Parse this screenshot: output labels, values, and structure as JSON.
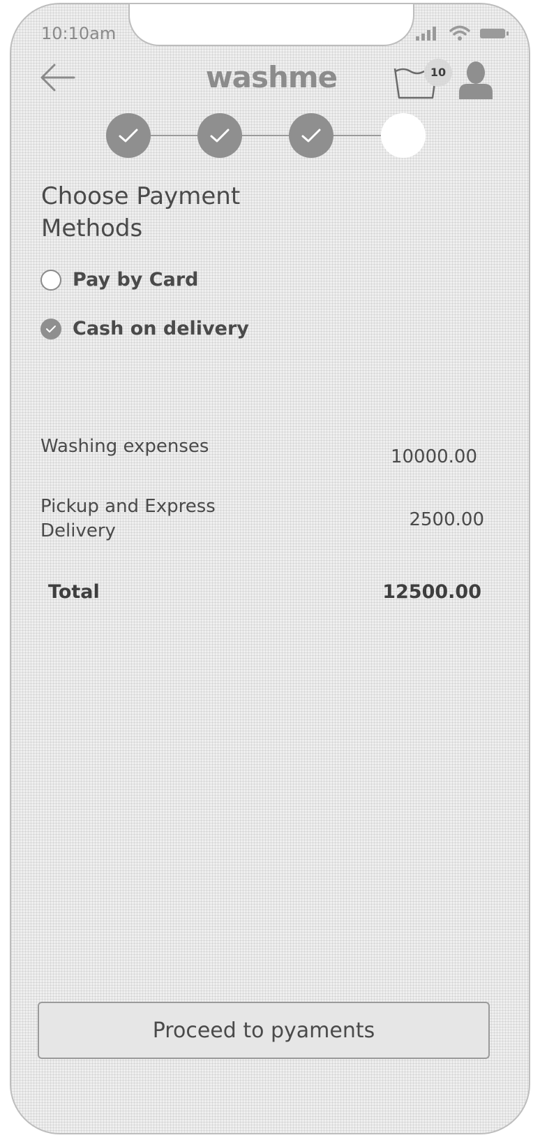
{
  "status_bar": {
    "time": "10:10am",
    "icons": [
      "signal-icon",
      "wifi-icon",
      "battery-icon"
    ]
  },
  "header": {
    "back_icon": "arrow-left-icon",
    "brand": "washme",
    "basket_icon": "laundry-basket-icon",
    "basket_count": "10",
    "profile_icon": "user-icon"
  },
  "stepper": {
    "total_steps": 4,
    "completed_steps": 3
  },
  "payment": {
    "heading": "Choose Payment Methods",
    "options": [
      {
        "label": "Pay by Card",
        "selected": false
      },
      {
        "label": "Cash on delivery",
        "selected": true
      }
    ]
  },
  "summary": {
    "rows": [
      {
        "label": "Washing expenses",
        "value": "10000.00"
      },
      {
        "label": "Pickup and Express Delivery",
        "value": "2500.00"
      }
    ],
    "total_label": "Total",
    "total_value": "12500.00"
  },
  "footer": {
    "proceed_label": "Proceed to pyaments"
  },
  "colors": {
    "background": "#efefef",
    "accent": "#8f8f8f",
    "text": "#4a4a4a",
    "button": "#e6e6e6"
  }
}
